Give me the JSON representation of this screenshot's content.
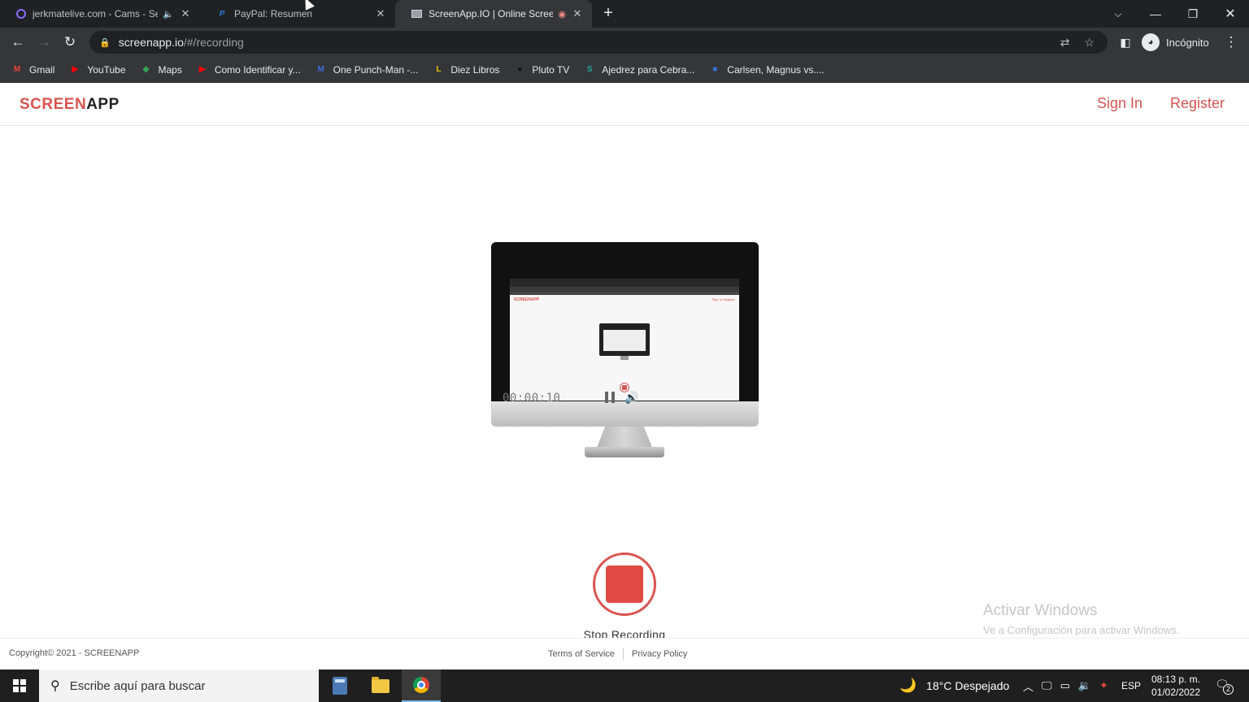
{
  "browser": {
    "tabs": [
      {
        "title": "jerkmatelive.com - Cams - Se",
        "favicon": "circle-icon"
      },
      {
        "title": "PayPal: Resumen",
        "favicon": "paypal-icon"
      },
      {
        "title": "ScreenApp.IO | Online Screen",
        "favicon": "monitor-icon"
      }
    ],
    "new_tab_label": "+",
    "address": {
      "host": "screenapp.io",
      "path": "/#/recording"
    },
    "profile_label": "Incógnito",
    "bookmarks": [
      {
        "label": "Gmail",
        "icon": "gmail-icon",
        "color": "#ea4335",
        "glyph": "M"
      },
      {
        "label": "YouTube",
        "icon": "youtube-icon",
        "color": "#ff0000",
        "glyph": "▶"
      },
      {
        "label": "Maps",
        "icon": "maps-icon",
        "color": "#34a853",
        "glyph": "◆"
      },
      {
        "label": "Como Identificar y...",
        "icon": "youtube-icon",
        "color": "#ff0000",
        "glyph": "▶"
      },
      {
        "label": "One Punch-Man -...",
        "icon": "manga-icon",
        "color": "#3b6fd8",
        "glyph": "M"
      },
      {
        "label": "Diez Libros",
        "icon": "book-icon",
        "color": "#f4c20d",
        "glyph": "L"
      },
      {
        "label": "Pluto TV",
        "icon": "tv-icon",
        "color": "#111111",
        "glyph": "●"
      },
      {
        "label": "Ajedrez para Cebra...",
        "icon": "chess-icon",
        "color": "#1ea69a",
        "glyph": "S"
      },
      {
        "label": "Carlsen, Magnus vs....",
        "icon": "chessboard-icon",
        "color": "#3b6fd8",
        "glyph": "■"
      }
    ]
  },
  "site": {
    "logo_part1": "SCREEN",
    "logo_part2": "APP",
    "sign_in": "Sign In",
    "register": "Register",
    "timer": "00:00:10",
    "mini_logo": "SCREENAPP",
    "mini_links": "Sign In  Register",
    "stop_label": "Stop Recording",
    "copyright": "Copyright©   2021 - SCREENAPP",
    "terms": "Terms of Service",
    "privacy": "Privacy Policy",
    "accent_color": "#d9534f"
  },
  "windows": {
    "activate_title": "Activar Windows",
    "activate_sub": "Ve a Configuración para activar Windows.",
    "search_placeholder": "Escribe aquí para buscar",
    "weather": "18°C  Despejado",
    "language": "ESP",
    "time": "08:13 p. m.",
    "date": "01/02/2022",
    "notification_count": "2"
  }
}
